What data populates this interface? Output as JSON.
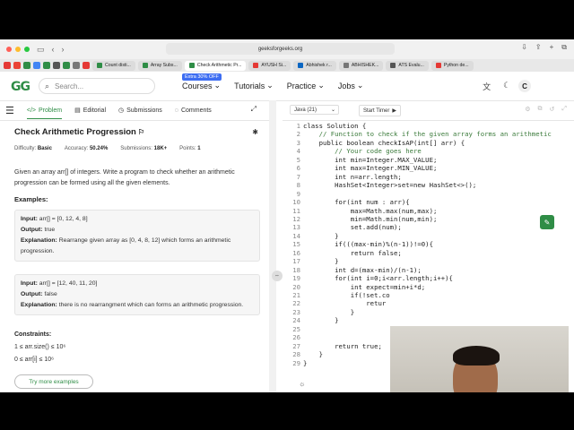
{
  "browser": {
    "url": "geeksforgeeks.org",
    "tabs": [
      "Count disti...",
      "Array Subs...",
      "Check Arithmetic Pr...",
      "AYUSH Si...",
      "Abhishek r...",
      "ABHISHEK...",
      "ATS Evalu...",
      "Python de..."
    ],
    "active_tab_index": 2
  },
  "header": {
    "logo": "GG",
    "search_placeholder": "Search...",
    "promo": "Extra 30% OFF",
    "nav": [
      "Courses",
      "Tutorials",
      "Practice",
      "Jobs"
    ],
    "avatar": "C"
  },
  "problem_tabs": [
    "Problem",
    "Editorial",
    "Submissions",
    "Comments"
  ],
  "problem": {
    "title": "Check Arithmetic Progression",
    "difficulty_label": "Difficulty:",
    "difficulty": "Basic",
    "accuracy_label": "Accuracy:",
    "accuracy": "50.24%",
    "submissions_label": "Submissions:",
    "submissions": "18K+",
    "points_label": "Points:",
    "points": "1",
    "description": "Given an array arr[] of integers. Write a program to check whether an arithmetic progression can be formed using all the given elements.",
    "examples_heading": "Examples:",
    "examples": [
      {
        "input_label": "Input:",
        "input": "arr[] = [0, 12, 4, 8]",
        "output_label": "Output:",
        "output": "true",
        "explanation_label": "Explanation:",
        "explanation": "Rearrange given array as [0, 4, 8, 12] which forms an arithmetic progression."
      },
      {
        "input_label": "Input:",
        "input": "arr[] = [12, 40, 11, 20]",
        "output_label": "Output:",
        "output": "false",
        "explanation_label": "Explanation:",
        "explanation": "there is no rearrangment which can forms an arithmetic progression."
      }
    ],
    "constraints_heading": "Constraints:",
    "constraints": [
      "1 ≤ arr.size() ≤ 10⁶",
      "0 ≤ arr[i] ≤ 10⁶"
    ],
    "try_more": "Try more examples"
  },
  "editor": {
    "language": "Java (21)",
    "timer": "Start Timer",
    "lines": [
      "class Solution {",
      "    // Function to check if the given array forms an arithmetic",
      "    public boolean checkIsAP(int[] arr) {",
      "        // Your code goes here",
      "        int min=Integer.MAX_VALUE;",
      "        int max=Integer.MIN_VALUE;",
      "        int n=arr.length;",
      "        HashSet<Integer>set=new HashSet<>();",
      "",
      "        for(int num : arr){",
      "            max=Math.max(num,max);",
      "            min=Math.min(num,min);",
      "            set.add(num);",
      "        }",
      "        if(((max-min)%(n-1))!=0){",
      "            return false;",
      "        }",
      "        int d=(max-min)/(n-1);",
      "        for(int i=0;i<arr.length;i++){",
      "            int expect=min+i*d;",
      "            if(!set.co",
      "                retur",
      "            }",
      "        }",
      "",
      "",
      "        return true;",
      "    }",
      "}"
    ]
  }
}
